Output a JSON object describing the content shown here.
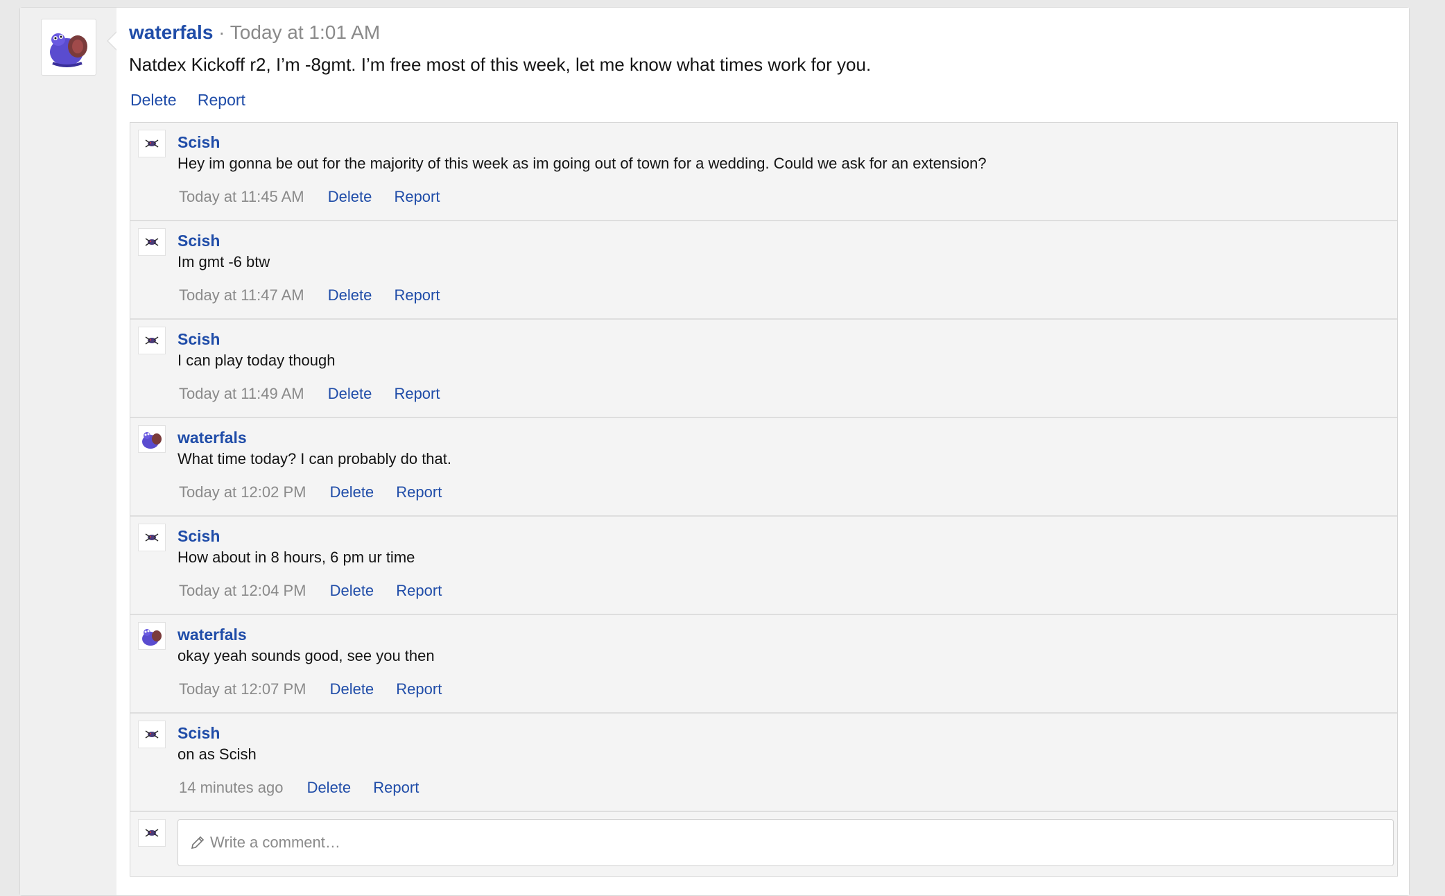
{
  "post": {
    "author": "waterfals",
    "separator": " · ",
    "time": "Today at 1:01 AM",
    "body": "Natdex Kickoff r2, I’m -8gmt. I’m free most of this week, let me know what times work for you.",
    "delete_label": "Delete",
    "report_label": "Report",
    "avatar_icon": "blob-monster-avatar-icon"
  },
  "comments": [
    {
      "author": "Scish",
      "text": "Hey im gonna be out for the majority of this week as im going out of town for a wedding. Could we ask for an extension?",
      "time": "Today at 11:45 AM",
      "delete_label": "Delete",
      "report_label": "Report"
    },
    {
      "author": "Scish",
      "text": "Im gmt -6 btw",
      "time": "Today at 11:47 AM",
      "delete_label": "Delete",
      "report_label": "Report"
    },
    {
      "author": "Scish",
      "text": "I can play today though",
      "time": "Today at 11:49 AM",
      "delete_label": "Delete",
      "report_label": "Report"
    },
    {
      "author": "waterfals",
      "text": "What time today? I can probably do that.",
      "time": "Today at 12:02 PM",
      "delete_label": "Delete",
      "report_label": "Report"
    },
    {
      "author": "Scish",
      "text": "How about in 8 hours, 6 pm ur time",
      "time": "Today at 12:04 PM",
      "delete_label": "Delete",
      "report_label": "Report"
    },
    {
      "author": "waterfals",
      "text": "okay yeah sounds good, see you then",
      "time": "Today at 12:07 PM",
      "delete_label": "Delete",
      "report_label": "Report"
    },
    {
      "author": "Scish",
      "text": "on as Scish",
      "time": "14 minutes ago",
      "delete_label": "Delete",
      "report_label": "Report"
    }
  ],
  "reply": {
    "placeholder": "Write a comment…",
    "icon": "pencil-icon"
  },
  "colors": {
    "link": "#1f4ca8",
    "muted": "#8a8a8a",
    "comment_bg": "#f4f4f4"
  }
}
